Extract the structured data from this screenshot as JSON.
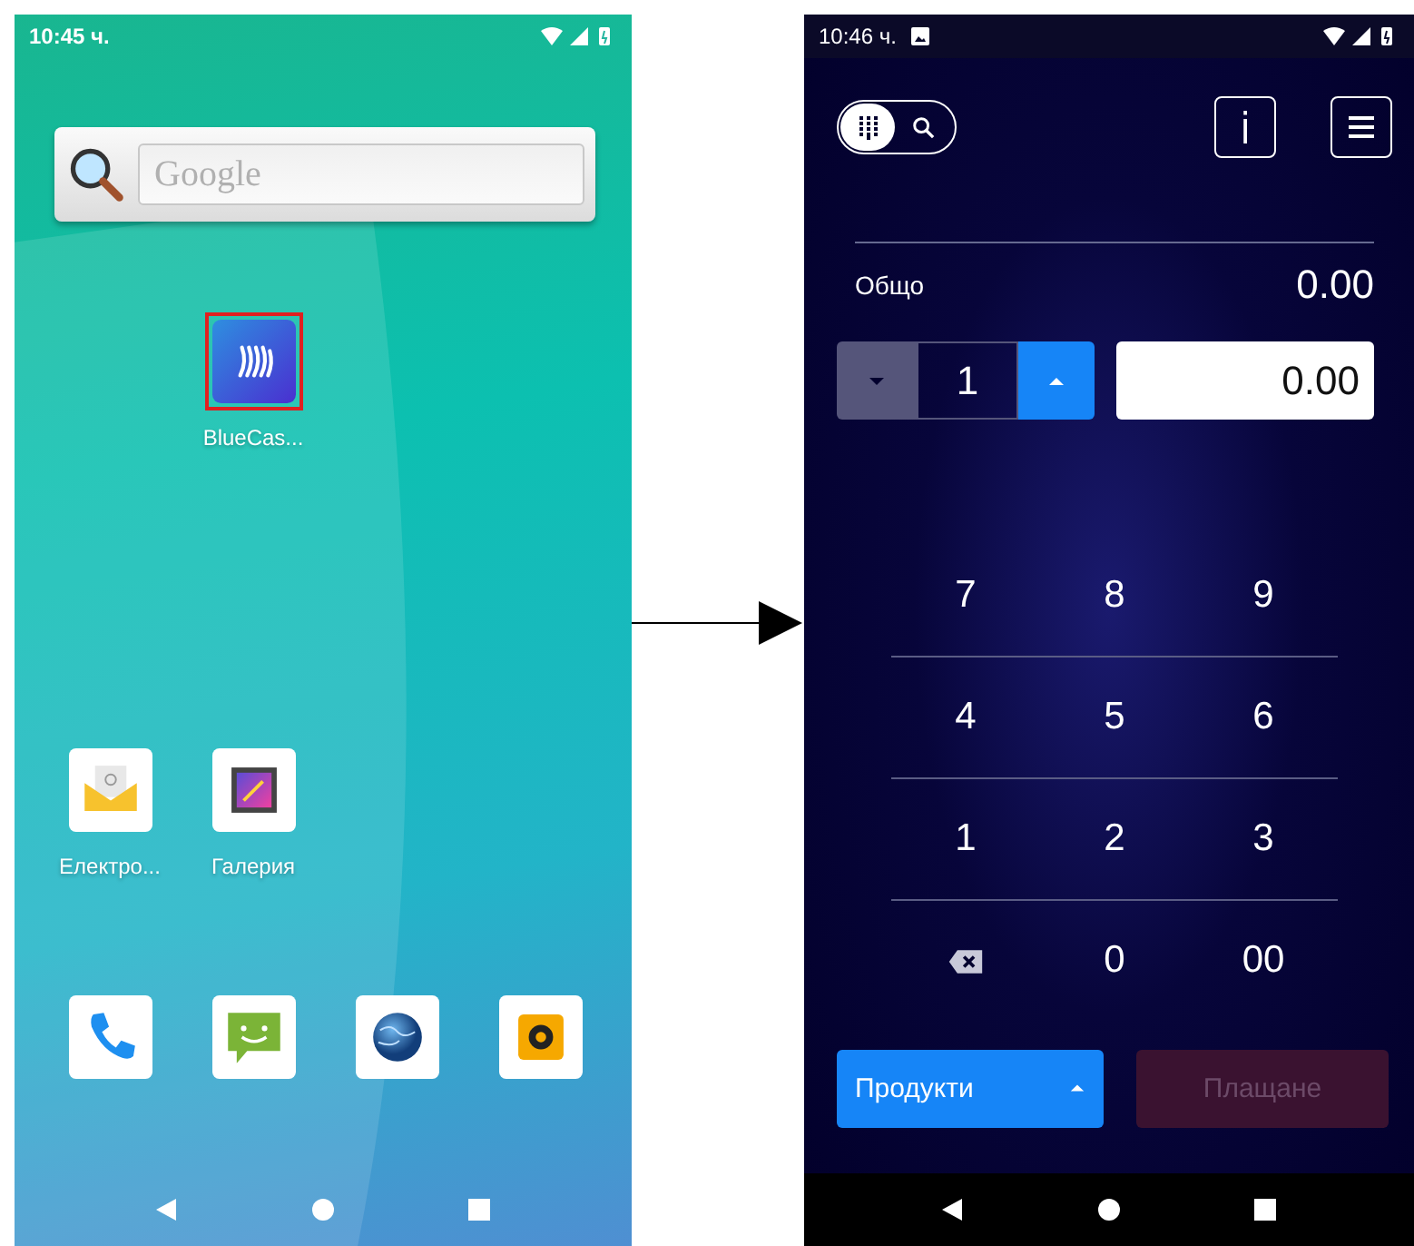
{
  "home_screen": {
    "status_bar": {
      "time": "10:45 ч."
    },
    "search_widget": {
      "placeholder": "Google"
    },
    "apps": [
      {
        "kind": "bluecash",
        "label": "BlueCas...",
        "highlighted": true
      }
    ],
    "favorites": [
      {
        "kind": "email",
        "label": "Електро...",
        "highlighted": false
      },
      {
        "kind": "gallery",
        "label": "Галерия",
        "highlighted": false
      }
    ],
    "dock": [
      {
        "kind": "phone"
      },
      {
        "kind": "messages"
      },
      {
        "kind": "browser"
      },
      {
        "kind": "camera"
      }
    ]
  },
  "app_screen": {
    "status_bar": {
      "time": "10:46 ч."
    },
    "mode_toggle": [
      {
        "kind": "keypad",
        "selected": true
      },
      {
        "kind": "search",
        "selected": false
      }
    ],
    "total": {
      "label": "Общо",
      "value": "0.00"
    },
    "quantity": {
      "value": "1"
    },
    "price_field": {
      "value": "0.00"
    },
    "keypad": [
      [
        {
          "kind": "digit",
          "label": "7"
        },
        {
          "kind": "digit",
          "label": "8"
        },
        {
          "kind": "digit",
          "label": "9"
        }
      ],
      [
        {
          "kind": "digit",
          "label": "4"
        },
        {
          "kind": "digit",
          "label": "5"
        },
        {
          "kind": "digit",
          "label": "6"
        }
      ],
      [
        {
          "kind": "digit",
          "label": "1"
        },
        {
          "kind": "digit",
          "label": "2"
        },
        {
          "kind": "digit",
          "label": "3"
        }
      ],
      [
        {
          "kind": "backspace"
        },
        {
          "kind": "digit",
          "label": "0"
        },
        {
          "kind": "digit",
          "label": "00"
        }
      ]
    ],
    "products_button": {
      "label": "Продукти"
    },
    "pay_button": {
      "label": "Плащане",
      "disabled": true
    }
  }
}
